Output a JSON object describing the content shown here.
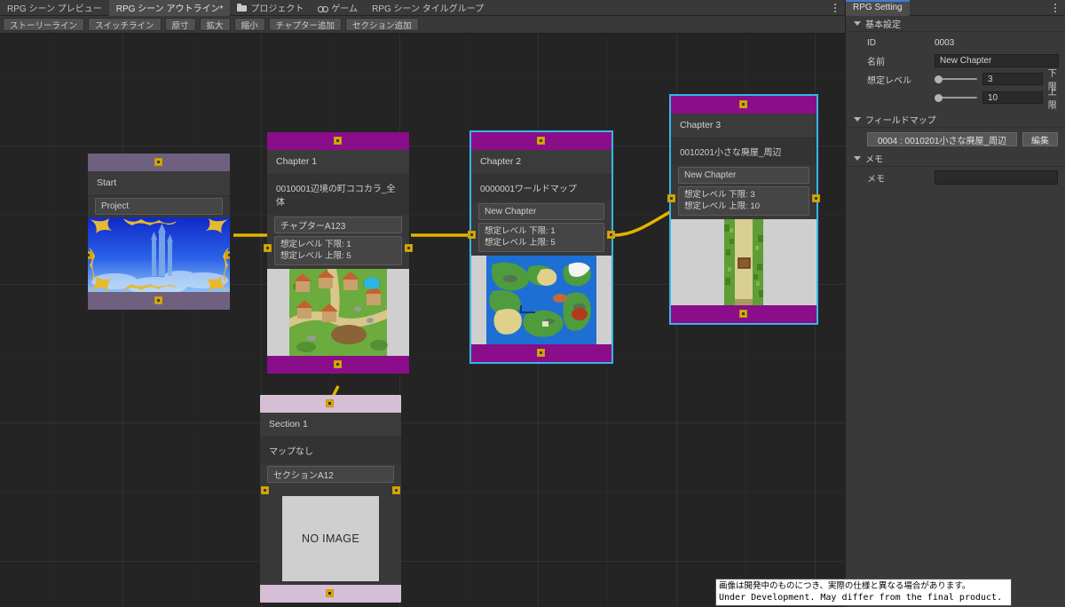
{
  "window": {
    "tabs": [
      {
        "label": "RPG シーン プレビュー",
        "icon": "",
        "active": false
      },
      {
        "label": "RPG シーン アウトライン*",
        "icon": "",
        "active": true
      },
      {
        "label": "プロジェクト",
        "icon": "folder-icon",
        "active": false
      },
      {
        "label": "ゲーム",
        "icon": "gamepad-icon",
        "active": false
      },
      {
        "label": "RPG シーン タイルグループ",
        "icon": "",
        "active": false
      }
    ],
    "menu_icon": "kebab-menu-icon"
  },
  "toolbar": {
    "buttons": [
      "ストーリーライン",
      "スイッチライン",
      "原寸",
      "拡大",
      "縮小",
      "チャプター追加",
      "セクション追加"
    ]
  },
  "graph": {
    "nodes": [
      {
        "id": "start",
        "kind": "start",
        "title": "Start",
        "name_field": "Project",
        "selected": false,
        "thumb_kind": "title-screen"
      },
      {
        "id": "chapter1",
        "kind": "chapter",
        "title": "Chapter 1",
        "map_label": "0010001辺境の町ココカラ_全体",
        "name_field": "チャプターA123",
        "level_min": "想定レベル 下限: 1",
        "level_max": "想定レベル 上限: 5",
        "selected": false,
        "thumb_kind": "village-map"
      },
      {
        "id": "chapter2",
        "kind": "chapter",
        "title": "Chapter 2",
        "map_label": "0000001ワールドマップ",
        "name_field": "New Chapter",
        "level_min": "想定レベル 下限: 1",
        "level_max": "想定レベル 上限: 5",
        "selected": true,
        "thumb_kind": "world-map"
      },
      {
        "id": "chapter3",
        "kind": "chapter",
        "title": "Chapter 3",
        "map_label": "0010201小さな廃屋_周辺",
        "name_field": "New Chapter",
        "level_min": "想定レベル 下限: 3",
        "level_max": "想定レベル 上限: 10",
        "selected": true,
        "thumb_kind": "road-map"
      },
      {
        "id": "section1",
        "kind": "section",
        "title": "Section 1",
        "map_label": "マップなし",
        "name_field": "セクションA12",
        "selected": false,
        "thumb_kind": "no-image",
        "no_image_text": "NO IMAGE"
      }
    ],
    "colors": {
      "chapter_band": "#8a0d8a",
      "start_band": "#6f6080",
      "section_band": "#d6bfd6",
      "edge": "#e3b400",
      "port": "#d6a800",
      "selection": "#39b5e8",
      "canvas_bg": "#242424"
    }
  },
  "inspector": {
    "tab_label": "RPG Setting",
    "menu_icon": "kebab-menu-icon",
    "basic": {
      "header": "基本設定",
      "id_label": "ID",
      "id_value": "0003",
      "name_label": "名前",
      "name_value": "New Chapter",
      "level_label": "想定レベル",
      "level_min_value": "3",
      "level_min_side": "下限",
      "level_max_value": "10",
      "level_max_side": "上限"
    },
    "fieldmap": {
      "header": "フィールドマップ",
      "object_value": "0004 : 0010201小さな廃屋_周辺",
      "edit_button": "編集"
    },
    "memo": {
      "header": "メモ",
      "label": "メモ",
      "value": ""
    }
  },
  "notice": {
    "japanese": "画像は開発中のものにつき、実際の仕様と異なる場合があります。",
    "english": "Under Development. May differ from the final product."
  }
}
